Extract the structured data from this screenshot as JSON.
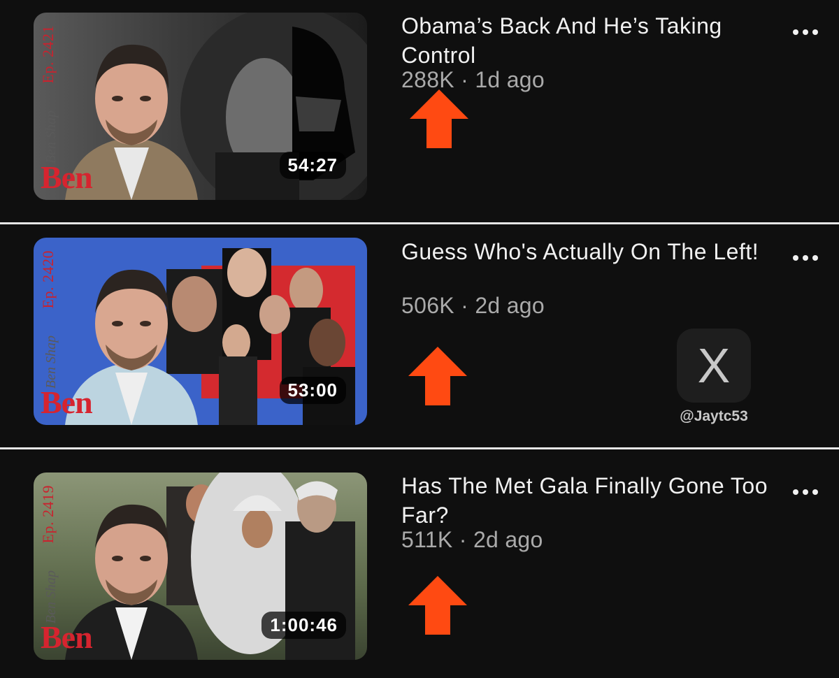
{
  "videos": [
    {
      "title": "Obama’s Back And He’s Taking Control",
      "views": "288K",
      "age": "1d ago",
      "duration": "54:27",
      "episode": "Ep. 2421",
      "brand": "Ben"
    },
    {
      "title": "Guess Who's Actually On The Left!",
      "views": "506K",
      "age": "2d ago",
      "duration": "53:00",
      "episode": "Ep. 2420",
      "brand": "Ben"
    },
    {
      "title": "Has The Met Gala Finally Gone Too Far?",
      "views": "511K",
      "age": "2d ago",
      "duration": "1:00:46",
      "episode": "Ep. 2419",
      "brand": "Ben"
    }
  ],
  "separator": "·",
  "watermark": {
    "icon": "x-logo-icon",
    "handle": "@Jaytc53"
  },
  "colors": {
    "background": "#0f0f0f",
    "annotation_arrow": "#ff4a12",
    "brand_red": "#d6242f"
  }
}
